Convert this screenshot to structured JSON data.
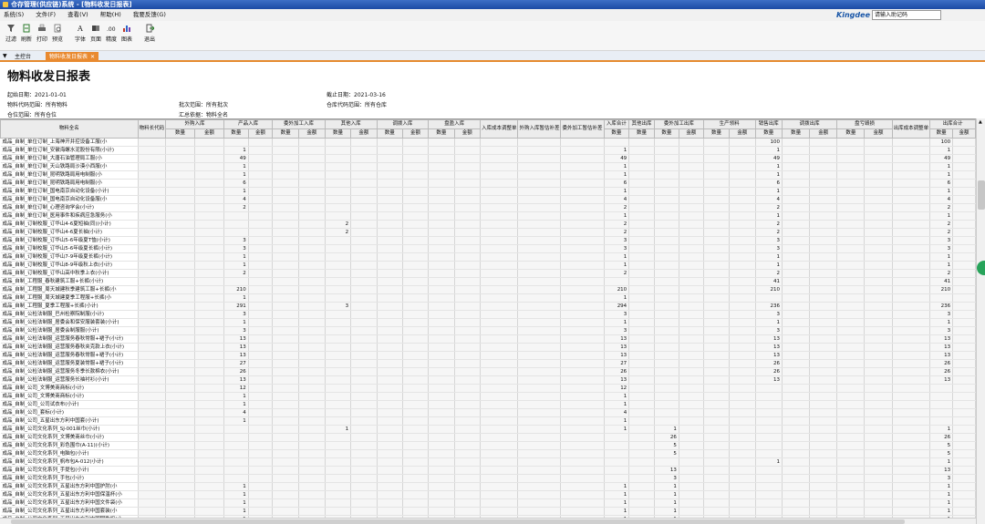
{
  "window": {
    "title": "仓存管理(供应链)系统 - [物料收发日报表]"
  },
  "menu": [
    "系统(S)",
    "文件(F)",
    "查看(V)",
    "帮助(H)",
    "我要反馈(G)"
  ],
  "brand": "Kingdee",
  "help_placeholder": "请输入助记码",
  "toolbar": [
    {
      "label": "过滤",
      "icon": "filter-icon"
    },
    {
      "label": "刷新",
      "icon": "refresh-icon"
    },
    {
      "label": "打印",
      "icon": "print-icon"
    },
    {
      "label": "预览",
      "icon": "preview-icon"
    },
    {
      "label": "字体",
      "icon": "font-icon"
    },
    {
      "label": "页面",
      "icon": "page-icon"
    },
    {
      "label": "精度",
      "icon": "precision-icon"
    },
    {
      "label": "图表",
      "icon": "chart-icon"
    },
    {
      "label": "退出",
      "icon": "exit-icon"
    }
  ],
  "tabs": {
    "home": "主控台",
    "active": "物料收发日报表"
  },
  "report": {
    "title": "物料收发日报表",
    "start_date": "起始日期：2021-01-01",
    "end_date": "截止日期：2021-03-16",
    "material_range": "物料代码范围：所有物料",
    "batch_range": "批次范围：所有批次",
    "warehouse_range": "仓库代码范围：所有仓库",
    "summary_basis": "汇总依据：物料全名",
    "location_range": "仓位范围：所有仓位"
  },
  "headers": {
    "top": [
      "物料全名",
      "物料长代码",
      "外购入库",
      "产品入库",
      "委外加工入库",
      "其他入库",
      "调拨入库",
      "盘盈入库",
      "入库成本调整单",
      "外购入库暂估补差",
      "委外加工暂估补差",
      "入库合计",
      "其他出库",
      "委外加工出库",
      "生产领料",
      "销售出库",
      "调拨出库",
      "盘亏毁损",
      "出库成本调整单",
      "出库合计"
    ],
    "qty": "数量",
    "amt": "金额"
  },
  "rows": [
    {
      "name": "成品_自制_单位订制_上海神开井控设备工服(小",
      "pi": "",
      "oi": "",
      "ti": "",
      "oo": "",
      "sale": "100",
      "tot": "100"
    },
    {
      "name": "成品_自制_单位订制_安徽海螺水泥股份有限(小计)",
      "pi": "1",
      "oi": "",
      "ti": "1",
      "oo": "",
      "sale": "1",
      "tot": "1"
    },
    {
      "name": "成品_自制_单位订制_大唐石油管理局工服(小",
      "pi": "49",
      "oi": "",
      "ti": "49",
      "oo": "",
      "sale": "49",
      "tot": "49"
    },
    {
      "name": "成品_自制_单位订制_天山铁路局沙漠小西服(小",
      "pi": "1",
      "oi": "",
      "ti": "1",
      "oo": "",
      "sale": "1",
      "tot": "1"
    },
    {
      "name": "成品_自制_单位订制_昆明铁路局用电制服(小",
      "pi": "1",
      "oi": "",
      "ti": "1",
      "oo": "",
      "sale": "1",
      "tot": "1"
    },
    {
      "name": "成品_自制_单位订制_昆明铁路局用电制服(小",
      "pi": "6",
      "oi": "",
      "ti": "6",
      "oo": "",
      "sale": "6",
      "tot": "6"
    },
    {
      "name": "成品_自制_单位订制_国电南京自动化设备(小计)",
      "pi": "1",
      "oi": "",
      "ti": "1",
      "oo": "",
      "sale": "1",
      "tot": "1"
    },
    {
      "name": "成品_自制_单位订制_国电南京自动化设备服(小",
      "pi": "4",
      "oi": "",
      "ti": "4",
      "oo": "",
      "sale": "4",
      "tot": "4"
    },
    {
      "name": "成品_自制_单位订制_心理咨询学会(小计)",
      "pi": "2",
      "oi": "",
      "ti": "2",
      "oo": "",
      "sale": "2",
      "tot": "2"
    },
    {
      "name": "成品_自制_单位订制_医用事件和疾病应急服务(小",
      "pi": "",
      "oi": "",
      "ti": "1",
      "oo": "",
      "sale": "1",
      "tot": "1"
    },
    {
      "name": "成品_自制_订制校服_订华山4-6夏短袖(同)(小计)",
      "pi": "",
      "oi": "2",
      "ti": "2",
      "oo": "",
      "sale": "2",
      "tot": "2"
    },
    {
      "name": "成品_自制_订制校服_订华山4-6夏长袖(小计)",
      "pi": "",
      "oi": "2",
      "ti": "2",
      "oo": "",
      "sale": "2",
      "tot": "2"
    },
    {
      "name": "成品_自制_订制校服_订华山5-6年级夏T恤(小计)",
      "pi": "3",
      "oi": "",
      "ti": "3",
      "oo": "",
      "sale": "3",
      "tot": "3"
    },
    {
      "name": "成品_自制_订制校服_订华山5-6年级夏长裤(小计)",
      "pi": "3",
      "oi": "",
      "ti": "3",
      "oo": "",
      "sale": "3",
      "tot": "3"
    },
    {
      "name": "成品_自制_订制校服_订华山7-9年级夏长裤(小计)",
      "pi": "1",
      "oi": "",
      "ti": "1",
      "oo": "",
      "sale": "1",
      "tot": "1"
    },
    {
      "name": "成品_自制_订制校服_订华山8-9年级秋上衣(小计)",
      "pi": "1",
      "oi": "",
      "ti": "1",
      "oo": "",
      "sale": "1",
      "tot": "1"
    },
    {
      "name": "成品_自制_订制校服_订华山高中秋季上衣(小计)",
      "pi": "2",
      "oi": "",
      "ti": "2",
      "oo": "",
      "sale": "2",
      "tot": "2"
    },
    {
      "name": "成品_自制_工程服_春秋建筑工服+长裤(小计)",
      "pi": "",
      "oi": "",
      "ti": "",
      "oo": "",
      "sale": "41",
      "tot": "41"
    },
    {
      "name": "成品_自制_工程服_周天城建秋季建筑工服+长裤(小",
      "pi": "210",
      "oi": "",
      "ti": "210",
      "oo": "",
      "sale": "210",
      "tot": "210"
    },
    {
      "name": "成品_自制_工程服_周天城建夏季工程服+长裤(小",
      "pi": "1",
      "oi": "",
      "ti": "1",
      "oo": "",
      "sale": "",
      "tot": ""
    },
    {
      "name": "成品_自制_工程服_夏季工程服+长裤(小计)",
      "pi": "291",
      "oi": "3",
      "ti": "294",
      "oo": "",
      "sale": "236",
      "tot": "236"
    },
    {
      "name": "成品_自制_公检法制服_巴州检察院制服(小计)",
      "pi": "3",
      "oi": "",
      "ti": "3",
      "oo": "",
      "sale": "3",
      "tot": "3"
    },
    {
      "name": "成品_自制_公检法制服_居委会和保安服装套装(小计)",
      "pi": "1",
      "oi": "",
      "ti": "1",
      "oo": "",
      "sale": "1",
      "tot": "1"
    },
    {
      "name": "成品_自制_公检法制服_居委会制服服(小计)",
      "pi": "3",
      "oi": "",
      "ti": "3",
      "oo": "",
      "sale": "3",
      "tot": "3"
    },
    {
      "name": "成品_自制_公检法制服_运营服务春秋常服+裙子(小计)",
      "pi": "13",
      "oi": "",
      "ti": "13",
      "oo": "",
      "sale": "13",
      "tot": "13"
    },
    {
      "name": "成品_自制_公检法制服_运营服务春秋夹克款上衣(小计)",
      "pi": "13",
      "oi": "",
      "ti": "13",
      "oo": "",
      "sale": "13",
      "tot": "13"
    },
    {
      "name": "成品_自制_公检法制服_运营服务春秋常服+裙子(小计)",
      "pi": "13",
      "oi": "",
      "ti": "13",
      "oo": "",
      "sale": "13",
      "tot": "13"
    },
    {
      "name": "成品_自制_公检法制服_运营服务夏装常服+裙子(小计)",
      "pi": "27",
      "oi": "",
      "ti": "27",
      "oo": "",
      "sale": "26",
      "tot": "26"
    },
    {
      "name": "成品_自制_公检法制服_运营服务冬季长款棉衣(小计)",
      "pi": "26",
      "oi": "",
      "ti": "26",
      "oo": "",
      "sale": "26",
      "tot": "26"
    },
    {
      "name": "成品_自制_公检法制服_运营服务长袖衬衫(小计)",
      "pi": "13",
      "oi": "",
      "ti": "13",
      "oo": "",
      "sale": "13",
      "tot": "13"
    },
    {
      "name": "成品_自制_公司_文博美商商标(小计)",
      "pi": "12",
      "oi": "",
      "ti": "12",
      "oo": "",
      "sale": "",
      "tot": ""
    },
    {
      "name": "成品_自制_公司_文博美商商标(小计)",
      "pi": "1",
      "oi": "",
      "ti": "1",
      "oo": "",
      "sale": "",
      "tot": ""
    },
    {
      "name": "成品_自制_公司_公司试衣布(小计)",
      "pi": "1",
      "oi": "",
      "ti": "1",
      "oo": "",
      "sale": "",
      "tot": ""
    },
    {
      "name": "成品_自制_公司_套标(小计)",
      "pi": "4",
      "oi": "",
      "ti": "4",
      "oo": "",
      "sale": "",
      "tot": ""
    },
    {
      "name": "成品_自制_公司_五星出东方利中国套(小计)",
      "pi": "1",
      "oi": "",
      "ti": "1",
      "oo": "",
      "sale": "",
      "tot": ""
    },
    {
      "name": "成品_自制_公司文化系列_SJ-001丝巾(小计)",
      "pi": "",
      "oi": "1",
      "ti": "1",
      "oo": "1",
      "sale": "",
      "tot": "1"
    },
    {
      "name": "成品_自制_公司文化系列_文博美商丝巾(小计)",
      "pi": "",
      "oi": "",
      "ti": "",
      "oo": "26",
      "sale": "",
      "tot": "26"
    },
    {
      "name": "成品_自制_公司文化系列_彩色围巾(A-11)(小计)",
      "pi": "",
      "oi": "",
      "ti": "",
      "oo": "5",
      "sale": "",
      "tot": "5"
    },
    {
      "name": "成品_自制_公司文化系列_电脑包(小计)",
      "pi": "",
      "oi": "",
      "ti": "",
      "oo": "5",
      "sale": "",
      "tot": "5"
    },
    {
      "name": "成品_自制_公司文化系列_帆布包A-012(小计)",
      "pi": "",
      "oi": "",
      "ti": "",
      "oo": "",
      "sale": "1",
      "tot": "1"
    },
    {
      "name": "成品_自制_公司文化系列_手提包(小计)",
      "pi": "",
      "oi": "",
      "ti": "",
      "oo": "13",
      "sale": "",
      "tot": "13"
    },
    {
      "name": "成品_自制_公司文化系列_手包(小计)",
      "pi": "",
      "oi": "",
      "ti": "",
      "oo": "3",
      "sale": "",
      "tot": "3"
    },
    {
      "name": "成品_自制_公司文化系列_五星出东方利中国护肘(小",
      "pi": "1",
      "oi": "",
      "ti": "1",
      "oo": "1",
      "sale": "",
      "tot": "1"
    },
    {
      "name": "成品_自制_公司文化系列_五星出东方利中国保温杯(小",
      "pi": "1",
      "oi": "",
      "ti": "1",
      "oo": "1",
      "sale": "",
      "tot": "1"
    },
    {
      "name": "成品_自制_公司文化系列_五星出东方利中国文件袋(小",
      "pi": "1",
      "oi": "",
      "ti": "1",
      "oo": "1",
      "sale": "",
      "tot": "1"
    },
    {
      "name": "成品_自制_公司文化系列_五星出东方利中国套装(小",
      "pi": "1",
      "oi": "",
      "ti": "1",
      "oo": "1",
      "sale": "",
      "tot": "1"
    },
    {
      "name": "成品_自制_公司文化系列_五星出东方利中国钥匙扣(小",
      "pi": "1",
      "oi": "",
      "ti": "1",
      "oo": "1",
      "sale": "",
      "tot": "1"
    }
  ]
}
